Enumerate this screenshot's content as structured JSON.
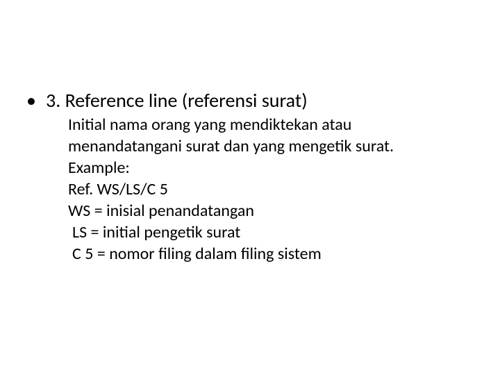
{
  "slide": {
    "bullet_heading": "3. Reference line (referensi surat)",
    "lines": {
      "l1": "Initial nama orang yang mendiktekan atau",
      "l2": "menandatangani surat dan yang mengetik surat.",
      "l3": "Example:",
      "l4": "Ref. WS/LS/C 5",
      "l5": "WS = inisial penandatangan",
      "l6": "LS = initial pengetik surat",
      "l7": "C 5 = nomor filing dalam filing sistem"
    },
    "bullet_char": "•"
  }
}
